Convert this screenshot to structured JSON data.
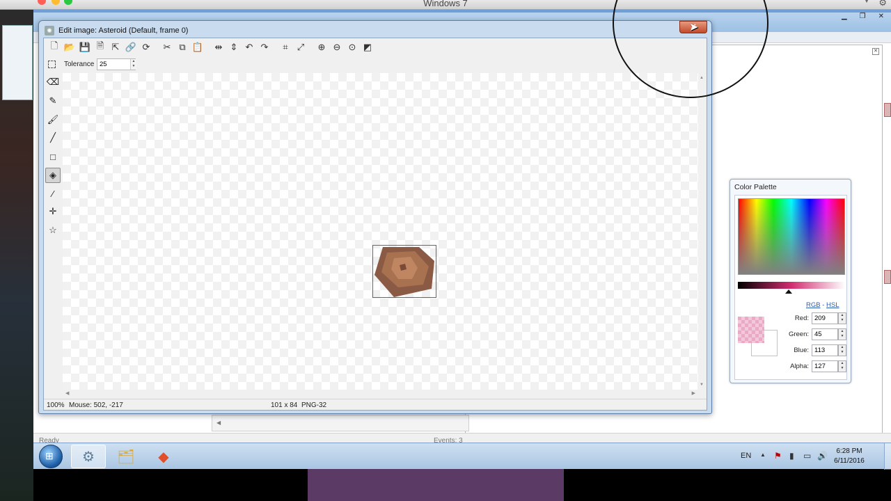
{
  "host": {
    "title": "Windows 7"
  },
  "ide": {
    "status_left": "Ready",
    "status_right": "Events: 3"
  },
  "editor": {
    "title": "Edit image: Asteroid (Default, frame 0)",
    "close_glyph": "✕",
    "toolbar": [
      {
        "name": "new-icon",
        "glyph": "🗋"
      },
      {
        "name": "open-icon",
        "glyph": "📂"
      },
      {
        "name": "save-icon",
        "glyph": "💾"
      },
      {
        "name": "save-as-icon",
        "glyph": "🗎"
      },
      {
        "name": "export-icon",
        "glyph": "⇱"
      },
      {
        "name": "link-icon",
        "glyph": "🔗"
      },
      {
        "name": "refresh-icon",
        "glyph": "⟳"
      },
      {
        "name": "cut-icon",
        "glyph": "✂"
      },
      {
        "name": "copy-icon",
        "glyph": "⧉"
      },
      {
        "name": "paste-icon",
        "glyph": "📋"
      },
      {
        "name": "flip-horizontal-icon",
        "glyph": "⇹"
      },
      {
        "name": "flip-vertical-icon",
        "glyph": "⇕"
      },
      {
        "name": "rotate-left-icon",
        "glyph": "↶"
      },
      {
        "name": "rotate-right-icon",
        "glyph": "↷"
      },
      {
        "name": "crop-icon",
        "glyph": "⌗"
      },
      {
        "name": "resize-icon",
        "glyph": "⤢"
      },
      {
        "name": "zoom-in-icon",
        "glyph": "⊕"
      },
      {
        "name": "zoom-out-icon",
        "glyph": "⊖"
      },
      {
        "name": "zoom-reset-icon",
        "glyph": "⊙"
      },
      {
        "name": "effects-icon",
        "glyph": "◩"
      }
    ],
    "tolerance_label": "Tolerance",
    "tolerance_value": "25",
    "tools": [
      {
        "name": "eraser-tool-icon",
        "glyph": "⌫"
      },
      {
        "name": "pencil-tool-icon",
        "glyph": "✎"
      },
      {
        "name": "brush-tool-icon",
        "glyph": "🖌"
      },
      {
        "name": "line-tool-icon",
        "glyph": "╱"
      },
      {
        "name": "rectangle-tool-icon",
        "glyph": "□"
      },
      {
        "name": "fill-bucket-tool-icon",
        "glyph": "◈"
      },
      {
        "name": "color-picker-tool-icon",
        "glyph": "⁄"
      },
      {
        "name": "select-tool-icon",
        "glyph": "✛"
      },
      {
        "name": "magic-wand-tool-icon",
        "glyph": "☆"
      }
    ],
    "selected_tool_index": 5,
    "status": {
      "zoom": "100%",
      "mouse": "Mouse: 502, -217",
      "size": "101 x 84",
      "format": "PNG-32"
    },
    "sprite_colors": {
      "outer": "#8b5a44",
      "mid": "#a8714f",
      "inner": "#c08561",
      "dark": "#7a4a36"
    }
  },
  "palette": {
    "title": "Color Palette",
    "rgb_link": "RGB",
    "separator": "-",
    "hsl_link": "HSL",
    "red_label": "Red:",
    "red_value": "209",
    "green_label": "Green:",
    "green_value": "45",
    "blue_label": "Blue:",
    "blue_value": "113",
    "alpha_label": "Alpha:",
    "alpha_value": "127",
    "current_color": "#d12d71"
  },
  "taskbar": {
    "apps": [
      {
        "name": "game-maker-icon",
        "glyph": "⚙",
        "active": true
      },
      {
        "name": "file-explorer-icon",
        "glyph": "🗂",
        "active": false
      },
      {
        "name": "git-icon",
        "glyph": "◆",
        "active": false
      }
    ],
    "language": "EN",
    "time": "6:28 PM",
    "date": "6/11/2016"
  }
}
